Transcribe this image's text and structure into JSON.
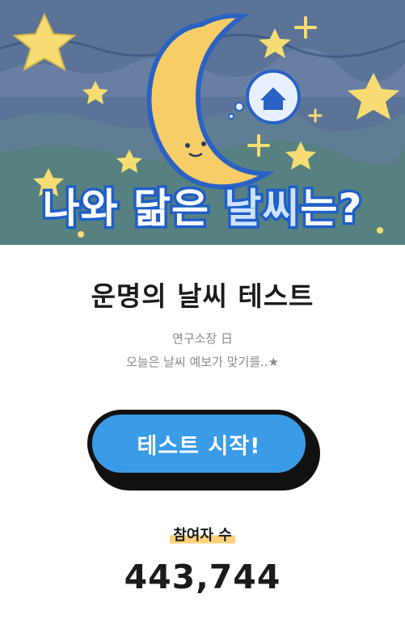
{
  "hero": {
    "title_part1": "나와 닮은 ",
    "title_part2": "날씨",
    "title_part3": "는?"
  },
  "page": {
    "title": "운명의 날씨 테스트",
    "author": "연구소장 日",
    "subtitle": "오늘은 날씨 예보가 맞기를..★"
  },
  "start_button": {
    "label": "테스트 시작!"
  },
  "participants": {
    "label": "참여자 수",
    "count": "443,744"
  },
  "colors": {
    "sky": "#5c7398",
    "moon": "#f6cd67",
    "star": "#f6dc72",
    "title_outline": "#1f5fc7",
    "button": "#3a9be6",
    "highlight": "#ffd27a"
  }
}
